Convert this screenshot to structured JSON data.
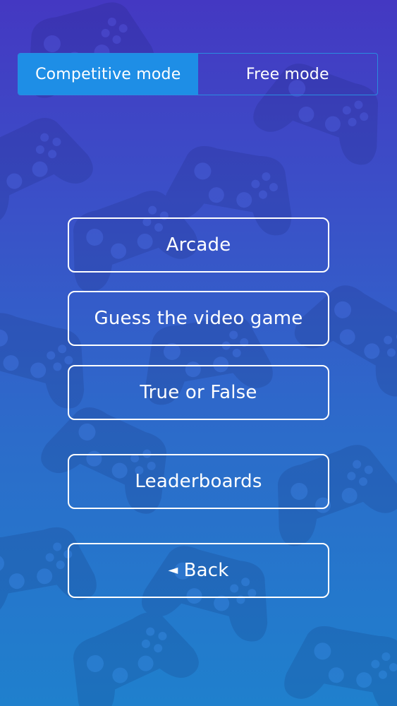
{
  "mode_switch": {
    "competitive_label": "Competitive mode",
    "free_label": "Free mode",
    "active": "competitive"
  },
  "menu": {
    "arcade_label": "Arcade",
    "guess_label": "Guess the video game",
    "true_false_label": "True or False",
    "leaderboards_label": "Leaderboards",
    "back_label": "Back",
    "back_icon": "◄"
  },
  "colors": {
    "bg_top": "#4438c2",
    "bg_bottom": "#1f80cd",
    "active_tab": "#1e8ee6",
    "tab_border": "#2a8be0",
    "button_border": "#ffffff"
  },
  "background_icon": "gamepad-icon"
}
